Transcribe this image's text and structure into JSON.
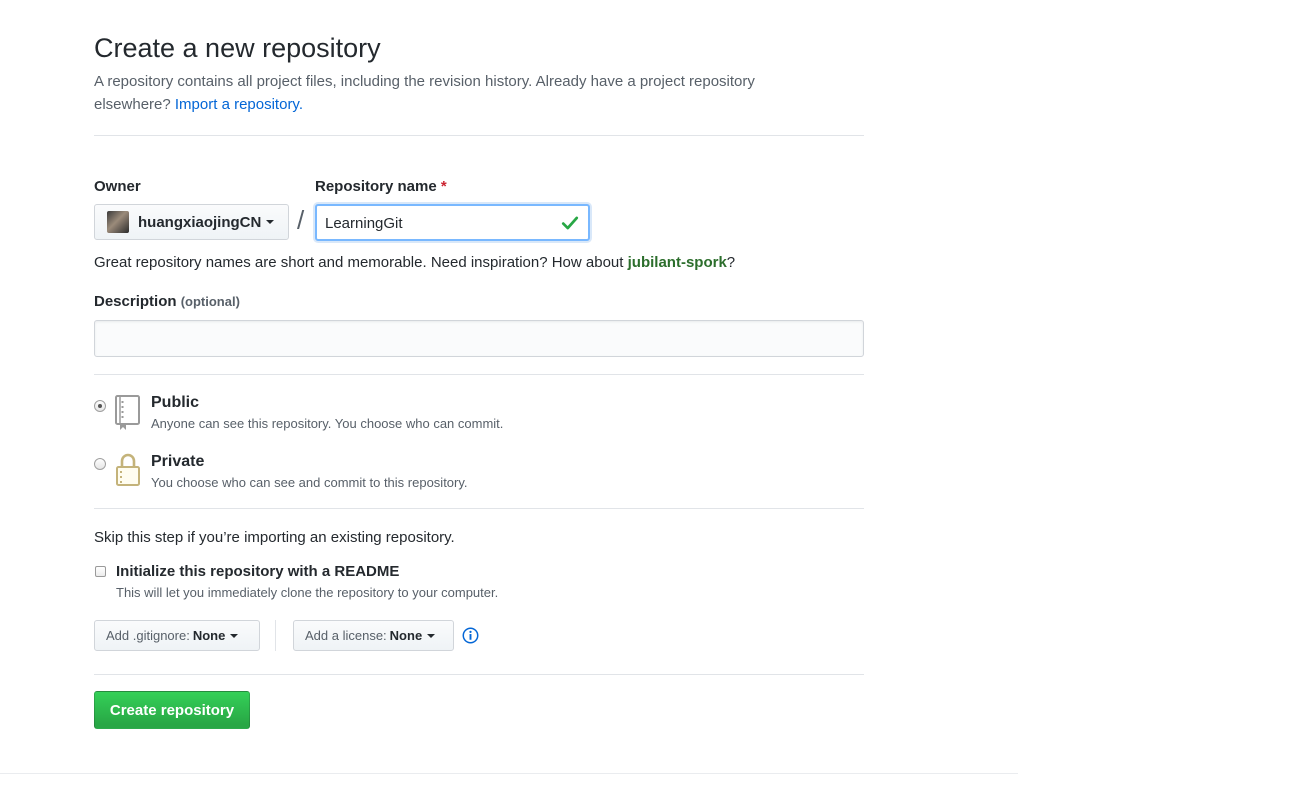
{
  "page": {
    "title": "Create a new repository",
    "description": "A repository contains all project files, including the revision history. Already have a project repository elsewhere?",
    "import_link": "Import a repository."
  },
  "owner": {
    "label": "Owner",
    "name": "huangxiaojingCN",
    "icon": "caret-down-icon"
  },
  "separator": "/",
  "repo_name": {
    "label": "Repository name",
    "required_mark": "*",
    "value": "LearningGit",
    "status_icon": "check-icon",
    "status_color": "#28a745"
  },
  "name_hint": {
    "text": "Great repository names are short and memorable. Need inspiration? How about",
    "suggestion": "jubilant-spork",
    "suffix": "?"
  },
  "description_field": {
    "label": "Description",
    "optional": "(optional)",
    "value": ""
  },
  "visibility": {
    "options": [
      {
        "title": "Public",
        "note": "Anyone can see this repository. You choose who can commit.",
        "icon": "repo-book-icon",
        "selected": true
      },
      {
        "title": "Private",
        "note": "You choose who can see and commit to this repository.",
        "icon": "lock-icon",
        "selected": false
      }
    ]
  },
  "init": {
    "skip_note": "Skip this step if you’re importing an existing repository.",
    "readme_label": "Initialize this repository with a README",
    "readme_note": "This will let you immediately clone the repository to your computer.",
    "readme_checked": false
  },
  "gitignore": {
    "label": "Add .gitignore:",
    "value": "None"
  },
  "license": {
    "label": "Add a license:",
    "value": "None",
    "info_icon": "info-icon"
  },
  "create_button": "Create repository",
  "colors": {
    "link": "#0366d6",
    "primary_button": "#28a745",
    "required": "#cb2431",
    "suggestion": "#2c6e2c"
  }
}
